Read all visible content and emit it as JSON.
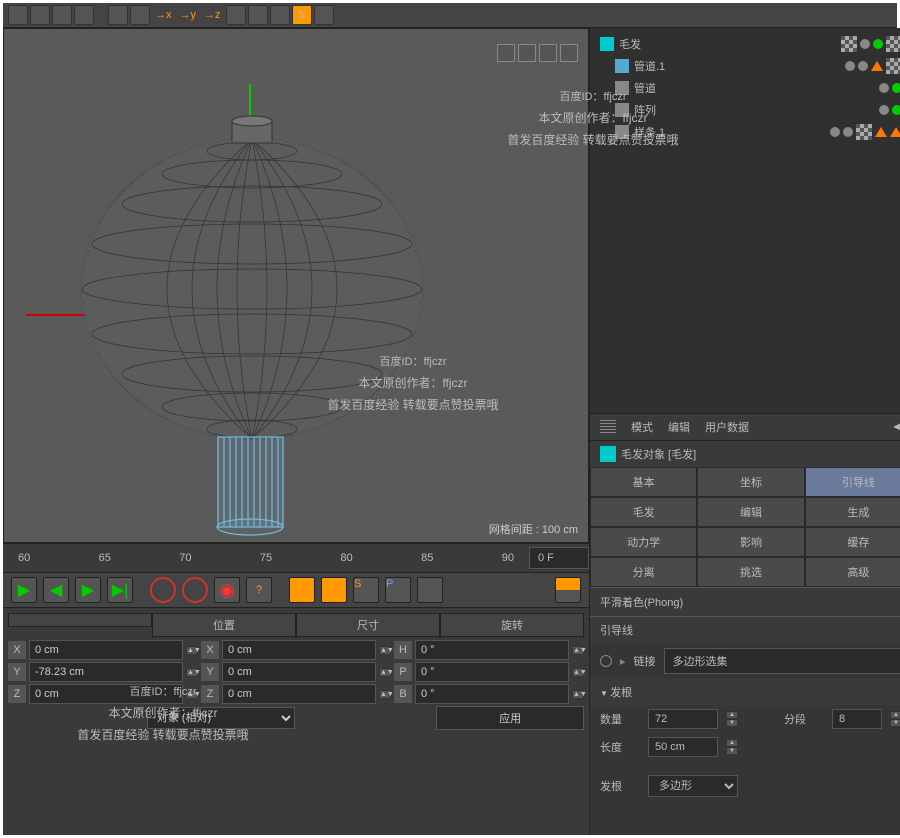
{
  "toolbar": {
    "axis_x": "→x",
    "axis_y": "→y",
    "axis_z": "→z"
  },
  "viewport": {
    "grid_label": "网格间距 : 100 cm"
  },
  "timeline": {
    "ticks": [
      "60",
      "65",
      "70",
      "75",
      "80",
      "85",
      "90"
    ],
    "frame": "0 F"
  },
  "objects": {
    "items": [
      {
        "name": "毛发",
        "icon": "hair"
      },
      {
        "name": "管道.1",
        "icon": "tube"
      },
      {
        "name": "管道",
        "icon": "gen"
      },
      {
        "name": "阵列",
        "icon": "gen"
      },
      {
        "name": "样条.1",
        "icon": "gen"
      }
    ]
  },
  "coords": {
    "headers": [
      "位置",
      "尺寸",
      "旋转"
    ],
    "rows": [
      {
        "l1": "X",
        "v1": "0 cm",
        "l2": "X",
        "v2": "0 cm",
        "l3": "H",
        "v3": "0 °"
      },
      {
        "l1": "Y",
        "v1": "-78.23 cm",
        "l2": "Y",
        "v2": "0 cm",
        "l3": "P",
        "v3": "0 °"
      },
      {
        "l1": "Z",
        "v1": "0 cm",
        "l2": "Z",
        "v2": "0 cm",
        "l3": "B",
        "v3": "0 °"
      }
    ],
    "mode": "对象 (相对)",
    "apply": "应用"
  },
  "attr_menu": {
    "mode": "模式",
    "edit": "编辑",
    "user": "用户数据"
  },
  "attr_title": "毛发对象 [毛发]",
  "tabs": [
    [
      "基本",
      "坐标",
      "引导线"
    ],
    [
      "毛发",
      "编辑",
      "生成"
    ],
    [
      "动力学",
      "影响",
      "缓存"
    ],
    [
      "分离",
      "挑选",
      "高级"
    ]
  ],
  "phong": "平滑着色(Phong)",
  "guide_section": "引导线",
  "link": {
    "label": "链接",
    "value": "多边形选集"
  },
  "roots": {
    "header": "发根",
    "count_label": "数量",
    "count": "72",
    "seg_label": "分段",
    "seg": "8",
    "length_label": "长度",
    "length": "50 cm",
    "root_label": "发根",
    "root_value": "多边形"
  },
  "watermark": {
    "id": "百度ID：ffjczr",
    "author": "本文原创作者：ffjczr",
    "note": "首发百度经验 转载要点赞投票哦"
  }
}
